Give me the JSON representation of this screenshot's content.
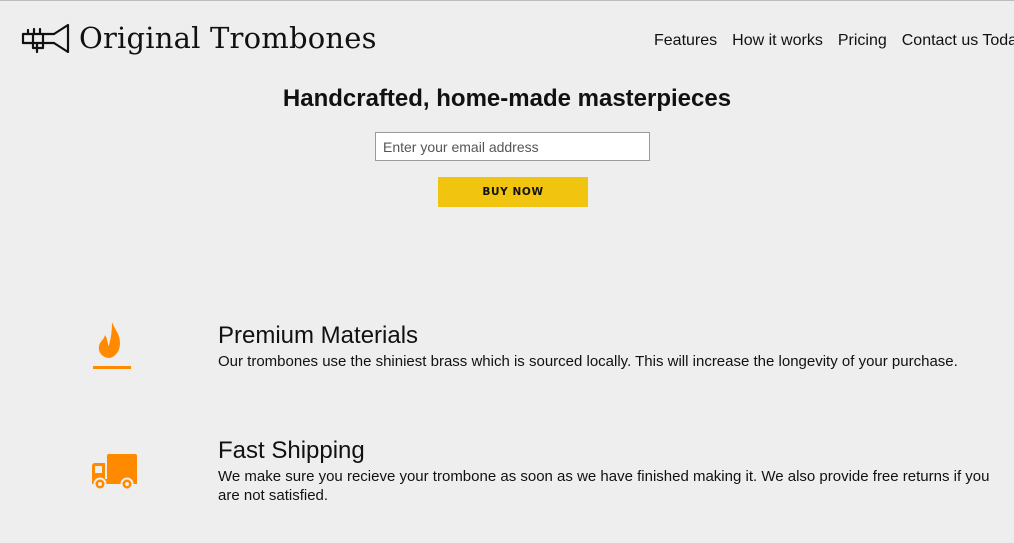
{
  "header": {
    "logo_icon": "trombone-icon",
    "logo_text": "Original Trombones",
    "nav": [
      {
        "label": "Features"
      },
      {
        "label": "How it works"
      },
      {
        "label": "Pricing"
      },
      {
        "label": "Contact us Today"
      }
    ]
  },
  "hero": {
    "title": "Handcrafted, home-made masterpieces",
    "email_placeholder": "Enter your email address",
    "buy_label": "BUY NOW"
  },
  "features": [
    {
      "icon": "fire-icon",
      "title": "Premium Materials",
      "description": "Our trombones use the shiniest brass which is sourced locally. This will increase the longevity of your purchase."
    },
    {
      "icon": "truck-icon",
      "title": "Fast Shipping",
      "description": "We make sure you recieve your trombone as soon as we have finished making it. We also provide free returns if you are not satisfied."
    }
  ],
  "colors": {
    "background": "#eeeeee",
    "accent_button": "#f1c40f",
    "icon_orange": "#ff8a00"
  }
}
